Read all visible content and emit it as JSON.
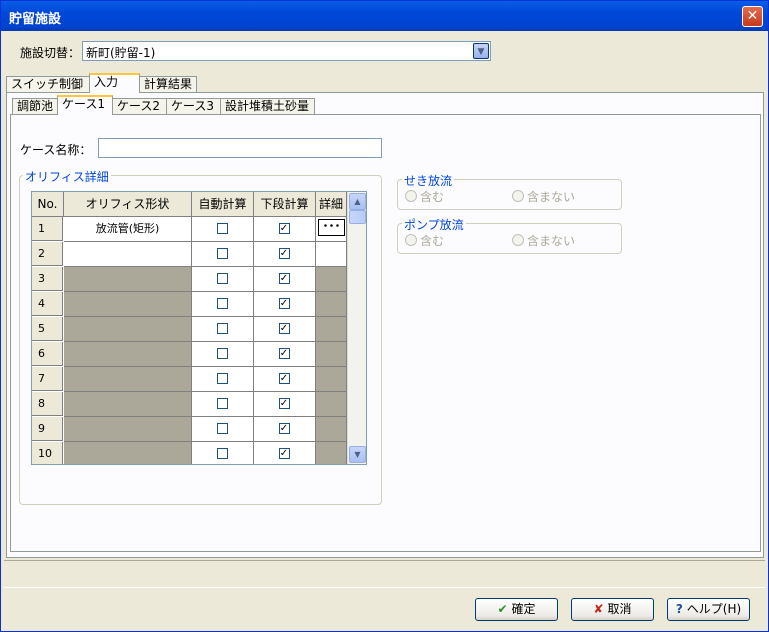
{
  "window": {
    "title": "貯留施設"
  },
  "facility": {
    "label": "施設切替：",
    "selected": "新町(貯留-1)"
  },
  "main_tabs": [
    {
      "label": "スイッチ制御"
    },
    {
      "label": "入力"
    },
    {
      "label": "計算結果"
    }
  ],
  "sub_tabs": [
    {
      "label": "調節池"
    },
    {
      "label": "ケース1"
    },
    {
      "label": "ケース2"
    },
    {
      "label": "ケース3"
    },
    {
      "label": "設計堆積土砂量"
    }
  ],
  "case_name": {
    "label": "ケース名称：",
    "value": ""
  },
  "orifice": {
    "title": "オリフィス詳細",
    "columns": [
      "No.",
      "オリフィス形状",
      "自動計算",
      "下段計算",
      "詳細"
    ],
    "rows": [
      {
        "no": "1",
        "shape": "放流管(矩形)",
        "auto": false,
        "lower": true,
        "detail": "･･･"
      },
      {
        "no": "2",
        "shape": "",
        "auto": false,
        "lower": true,
        "detail": ""
      },
      {
        "no": "3",
        "shape": "",
        "auto": false,
        "lower": true,
        "detail": ""
      },
      {
        "no": "4",
        "shape": "",
        "auto": false,
        "lower": true,
        "detail": ""
      },
      {
        "no": "5",
        "shape": "",
        "auto": false,
        "lower": true,
        "detail": ""
      },
      {
        "no": "6",
        "shape": "",
        "auto": false,
        "lower": true,
        "detail": ""
      },
      {
        "no": "7",
        "shape": "",
        "auto": false,
        "lower": true,
        "detail": ""
      },
      {
        "no": "8",
        "shape": "",
        "auto": false,
        "lower": true,
        "detail": ""
      },
      {
        "no": "9",
        "shape": "",
        "auto": false,
        "lower": true,
        "detail": ""
      },
      {
        "no": "10",
        "shape": "",
        "auto": false,
        "lower": true,
        "detail": ""
      }
    ]
  },
  "weir": {
    "title": "せき放流",
    "opt1": "含む",
    "opt2": "含まない"
  },
  "pump": {
    "title": "ポンプ放流",
    "opt1": "含む",
    "opt2": "含まない"
  },
  "buttons": {
    "ok": "確定",
    "cancel": "取消",
    "help": "ヘルプ(H)"
  },
  "colors": {
    "title_bar": "#0054e3",
    "group_title": "#0046d5",
    "disabled_cell": "#aca899"
  }
}
